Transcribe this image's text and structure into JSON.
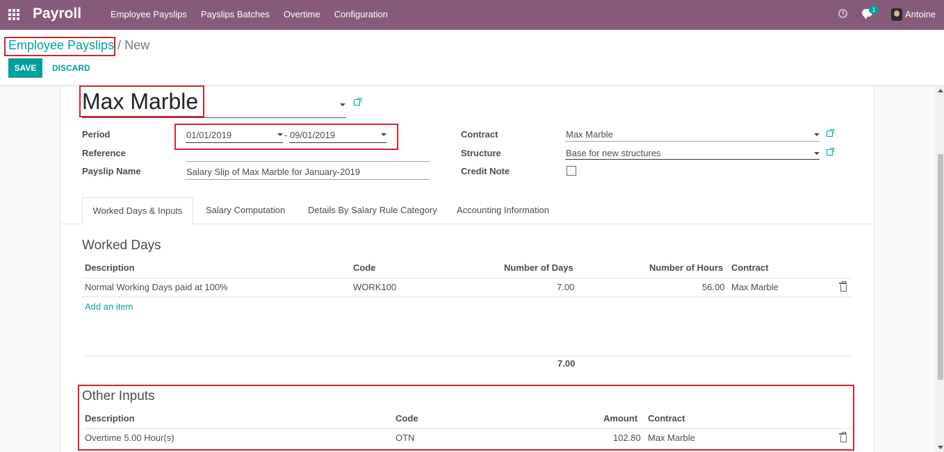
{
  "navbar": {
    "brand": "Payroll",
    "menu": [
      "Employee Payslips",
      "Payslips Batches",
      "Overtime",
      "Configuration"
    ],
    "messages_count": "1",
    "user": "Antoine"
  },
  "breadcrumb": {
    "parent": "Employee Payslips",
    "separator": "/",
    "current": "New"
  },
  "actions": {
    "save": "SAVE",
    "discard": "DISCARD"
  },
  "form": {
    "employee": "Max Marble",
    "period_label": "Period",
    "period_start": "01/01/2019",
    "period_separator": "-",
    "period_end": "09/01/2019",
    "reference_label": "Reference",
    "reference_value": "",
    "payslip_name_label": "Payslip Name",
    "payslip_name": "Salary Slip of Max Marble for January-2019",
    "contract_label": "Contract",
    "contract": "Max Marble",
    "structure_label": "Structure",
    "structure": "Base for new structures",
    "credit_note_label": "Credit Note",
    "credit_note": false
  },
  "tabs": [
    "Worked Days & Inputs",
    "Salary Computation",
    "Details By Salary Rule Category",
    "Accounting Information"
  ],
  "worked_days": {
    "title": "Worked Days",
    "columns": [
      "Description",
      "Code",
      "Number of Days",
      "Number of Hours",
      "Contract"
    ],
    "rows": [
      {
        "description": "Normal Working Days paid at 100%",
        "code": "WORK100",
        "days": "7.00",
        "hours": "56.00",
        "contract": "Max Marble"
      }
    ],
    "add_item": "Add an item",
    "total_days": "7.00"
  },
  "other_inputs": {
    "title": "Other Inputs",
    "columns": [
      "Description",
      "Code",
      "Amount",
      "Contract"
    ],
    "rows": [
      {
        "description": "Overtime 5.00 Hour(s)",
        "code": "OTN",
        "amount": "102.80",
        "contract": "Max Marble"
      }
    ]
  }
}
